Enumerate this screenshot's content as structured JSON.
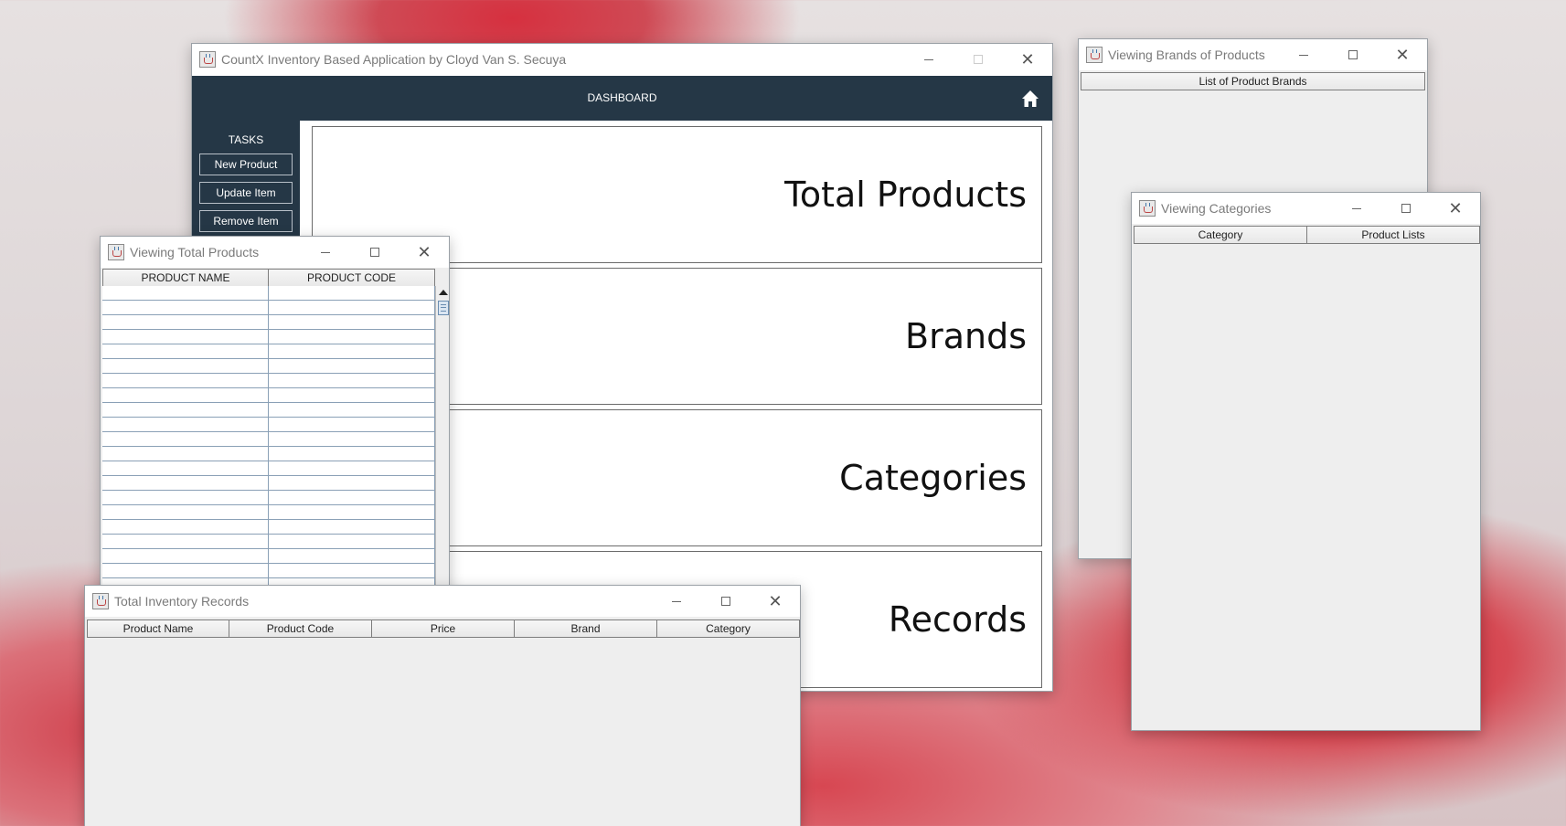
{
  "main_window": {
    "title": "CountX Inventory Based Application by Cloyd Van S. Secuya",
    "header": "DASHBOARD",
    "tasks_label": "TASKS",
    "task_buttons": [
      "New Product",
      "Update Item",
      "Remove Item"
    ],
    "cards": [
      "Total Products",
      "Brands",
      "Categories",
      "Records"
    ],
    "colors": {
      "navbar": "#253746"
    }
  },
  "brands_window": {
    "title": "Viewing Brands of Products",
    "columns": [
      "List of Product Brands"
    ]
  },
  "categories_window": {
    "title": "Viewing Categories",
    "columns": [
      "Category",
      "Product Lists"
    ]
  },
  "products_window": {
    "title": "Viewing Total Products",
    "columns": [
      "PRODUCT NAME",
      "PRODUCT CODE"
    ]
  },
  "records_window": {
    "title": "Total Inventory Records",
    "columns": [
      "Product Name",
      "Product Code",
      "Price",
      "Brand",
      "Category"
    ]
  }
}
